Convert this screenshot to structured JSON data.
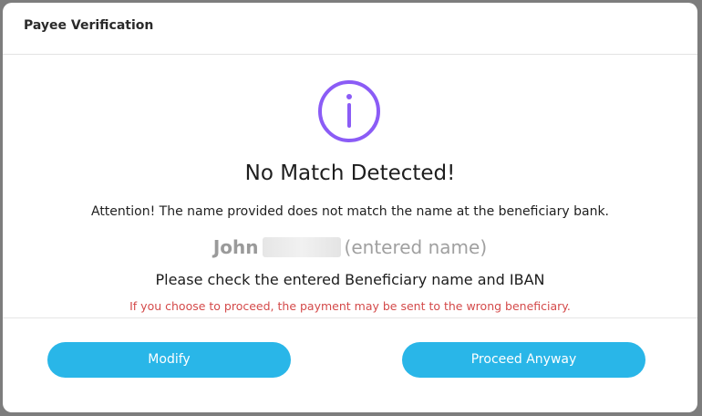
{
  "dialog": {
    "title": "Payee Verification"
  },
  "message": {
    "headline": "No Match Detected!",
    "attention": "Attention! The name provided does not match the name at the beneficiary bank.",
    "entered_first_name": "John",
    "entered_name_suffix": "(entered name)",
    "check_instruction": "Please check the entered Beneficiary name and IBAN",
    "warning": "If you choose to proceed, the payment may be sent to the wrong beneficiary."
  },
  "actions": {
    "modify_label": "Modify",
    "proceed_label": "Proceed Anyway"
  },
  "icons": {
    "status": "info-icon"
  },
  "colors": {
    "accent": "#29b6e8",
    "info_icon": "#8b5cf6",
    "warning_text": "#d44a4a"
  }
}
